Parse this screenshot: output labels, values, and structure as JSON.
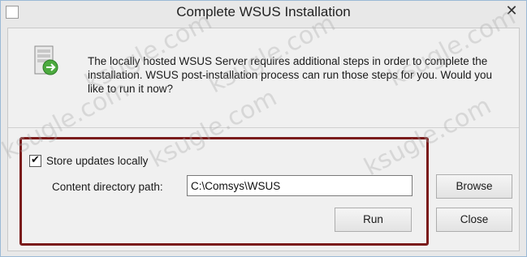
{
  "window": {
    "title": "Complete WSUS Installation",
    "close_glyph": "✕"
  },
  "message": {
    "text": "The locally hosted WSUS Server requires additional steps in order to complete the installation. WSUS post-installation process can run those steps for you. Would you like to run it now?"
  },
  "options": {
    "store_updates_label": "Store updates locally",
    "store_updates_checked": true,
    "content_path_label": "Content directory path:",
    "content_path_value": "C:\\Comsys\\WSUS"
  },
  "buttons": {
    "browse": "Browse",
    "run": "Run",
    "close": "Close"
  },
  "watermarks": [
    "ksugle.com",
    "ksugle.com",
    "ksugle.com",
    "ksugle.com",
    "ksugle.com",
    "ksugle.com"
  ],
  "colors": {
    "highlight_box": "#7a1b1b",
    "window_border": "#9bbad6"
  }
}
